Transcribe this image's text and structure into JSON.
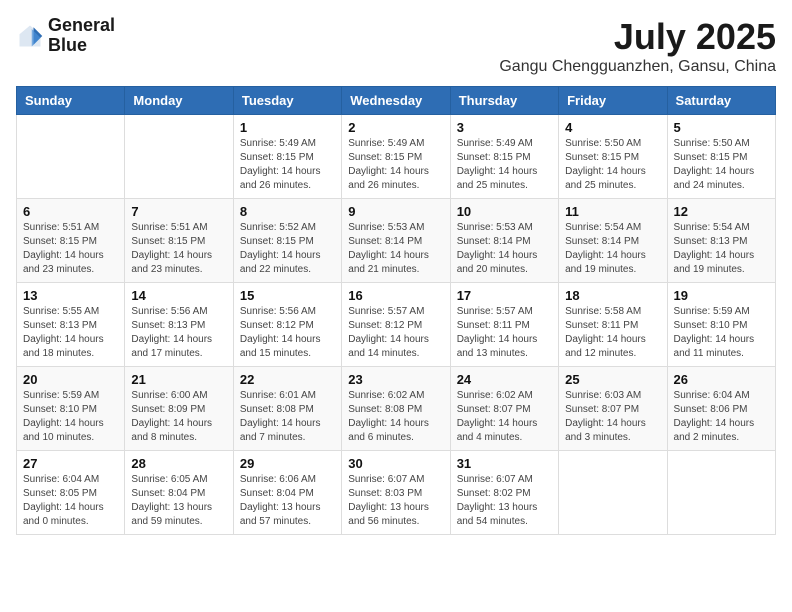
{
  "header": {
    "logo_line1": "General",
    "logo_line2": "Blue",
    "title": "July 2025",
    "subtitle": "Gangu Chengguanzhen, Gansu, China"
  },
  "weekdays": [
    "Sunday",
    "Monday",
    "Tuesday",
    "Wednesday",
    "Thursday",
    "Friday",
    "Saturday"
  ],
  "weeks": [
    [
      {
        "day": "",
        "info": ""
      },
      {
        "day": "",
        "info": ""
      },
      {
        "day": "1",
        "info": "Sunrise: 5:49 AM\nSunset: 8:15 PM\nDaylight: 14 hours and 26 minutes."
      },
      {
        "day": "2",
        "info": "Sunrise: 5:49 AM\nSunset: 8:15 PM\nDaylight: 14 hours and 26 minutes."
      },
      {
        "day": "3",
        "info": "Sunrise: 5:49 AM\nSunset: 8:15 PM\nDaylight: 14 hours and 25 minutes."
      },
      {
        "day": "4",
        "info": "Sunrise: 5:50 AM\nSunset: 8:15 PM\nDaylight: 14 hours and 25 minutes."
      },
      {
        "day": "5",
        "info": "Sunrise: 5:50 AM\nSunset: 8:15 PM\nDaylight: 14 hours and 24 minutes."
      }
    ],
    [
      {
        "day": "6",
        "info": "Sunrise: 5:51 AM\nSunset: 8:15 PM\nDaylight: 14 hours and 23 minutes."
      },
      {
        "day": "7",
        "info": "Sunrise: 5:51 AM\nSunset: 8:15 PM\nDaylight: 14 hours and 23 minutes."
      },
      {
        "day": "8",
        "info": "Sunrise: 5:52 AM\nSunset: 8:15 PM\nDaylight: 14 hours and 22 minutes."
      },
      {
        "day": "9",
        "info": "Sunrise: 5:53 AM\nSunset: 8:14 PM\nDaylight: 14 hours and 21 minutes."
      },
      {
        "day": "10",
        "info": "Sunrise: 5:53 AM\nSunset: 8:14 PM\nDaylight: 14 hours and 20 minutes."
      },
      {
        "day": "11",
        "info": "Sunrise: 5:54 AM\nSunset: 8:14 PM\nDaylight: 14 hours and 19 minutes."
      },
      {
        "day": "12",
        "info": "Sunrise: 5:54 AM\nSunset: 8:13 PM\nDaylight: 14 hours and 19 minutes."
      }
    ],
    [
      {
        "day": "13",
        "info": "Sunrise: 5:55 AM\nSunset: 8:13 PM\nDaylight: 14 hours and 18 minutes."
      },
      {
        "day": "14",
        "info": "Sunrise: 5:56 AM\nSunset: 8:13 PM\nDaylight: 14 hours and 17 minutes."
      },
      {
        "day": "15",
        "info": "Sunrise: 5:56 AM\nSunset: 8:12 PM\nDaylight: 14 hours and 15 minutes."
      },
      {
        "day": "16",
        "info": "Sunrise: 5:57 AM\nSunset: 8:12 PM\nDaylight: 14 hours and 14 minutes."
      },
      {
        "day": "17",
        "info": "Sunrise: 5:57 AM\nSunset: 8:11 PM\nDaylight: 14 hours and 13 minutes."
      },
      {
        "day": "18",
        "info": "Sunrise: 5:58 AM\nSunset: 8:11 PM\nDaylight: 14 hours and 12 minutes."
      },
      {
        "day": "19",
        "info": "Sunrise: 5:59 AM\nSunset: 8:10 PM\nDaylight: 14 hours and 11 minutes."
      }
    ],
    [
      {
        "day": "20",
        "info": "Sunrise: 5:59 AM\nSunset: 8:10 PM\nDaylight: 14 hours and 10 minutes."
      },
      {
        "day": "21",
        "info": "Sunrise: 6:00 AM\nSunset: 8:09 PM\nDaylight: 14 hours and 8 minutes."
      },
      {
        "day": "22",
        "info": "Sunrise: 6:01 AM\nSunset: 8:08 PM\nDaylight: 14 hours and 7 minutes."
      },
      {
        "day": "23",
        "info": "Sunrise: 6:02 AM\nSunset: 8:08 PM\nDaylight: 14 hours and 6 minutes."
      },
      {
        "day": "24",
        "info": "Sunrise: 6:02 AM\nSunset: 8:07 PM\nDaylight: 14 hours and 4 minutes."
      },
      {
        "day": "25",
        "info": "Sunrise: 6:03 AM\nSunset: 8:07 PM\nDaylight: 14 hours and 3 minutes."
      },
      {
        "day": "26",
        "info": "Sunrise: 6:04 AM\nSunset: 8:06 PM\nDaylight: 14 hours and 2 minutes."
      }
    ],
    [
      {
        "day": "27",
        "info": "Sunrise: 6:04 AM\nSunset: 8:05 PM\nDaylight: 14 hours and 0 minutes."
      },
      {
        "day": "28",
        "info": "Sunrise: 6:05 AM\nSunset: 8:04 PM\nDaylight: 13 hours and 59 minutes."
      },
      {
        "day": "29",
        "info": "Sunrise: 6:06 AM\nSunset: 8:04 PM\nDaylight: 13 hours and 57 minutes."
      },
      {
        "day": "30",
        "info": "Sunrise: 6:07 AM\nSunset: 8:03 PM\nDaylight: 13 hours and 56 minutes."
      },
      {
        "day": "31",
        "info": "Sunrise: 6:07 AM\nSunset: 8:02 PM\nDaylight: 13 hours and 54 minutes."
      },
      {
        "day": "",
        "info": ""
      },
      {
        "day": "",
        "info": ""
      }
    ]
  ]
}
